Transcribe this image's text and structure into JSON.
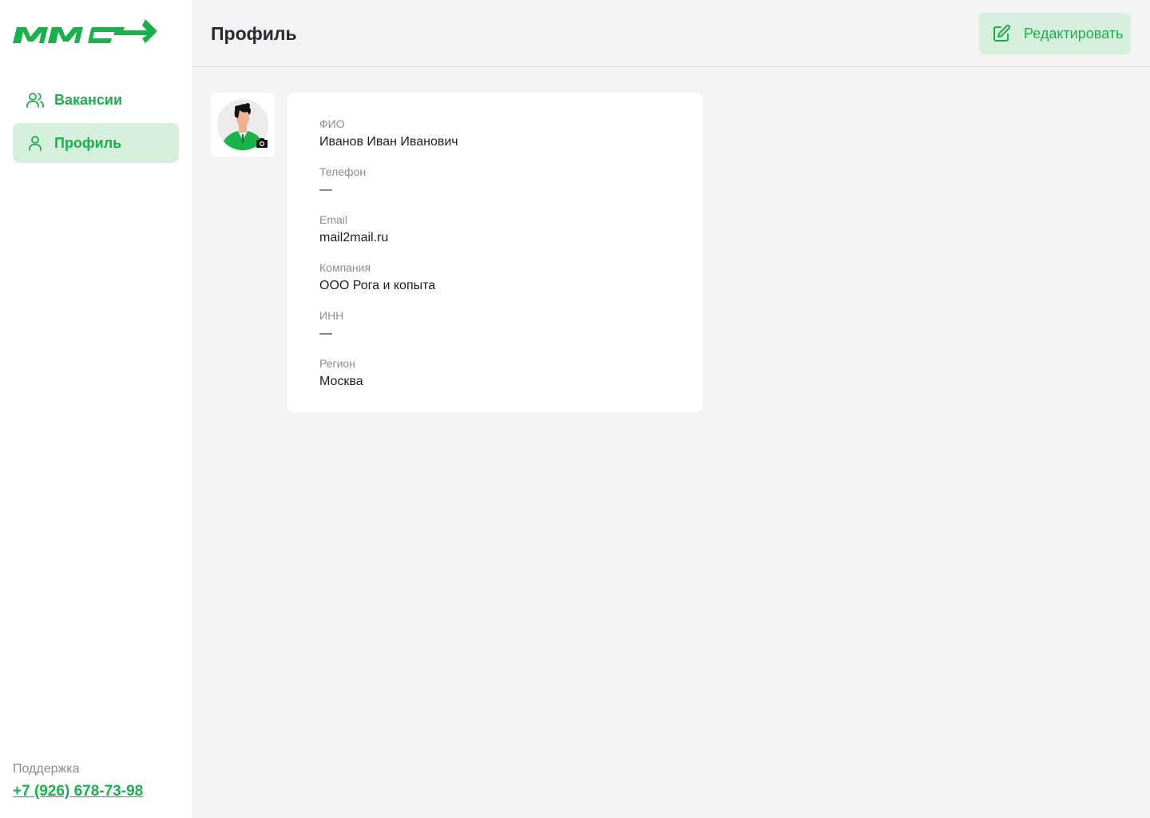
{
  "brand": {
    "logo_text": "MMC",
    "accent_color": "#17b24a",
    "accent_bg": "#d7f0de"
  },
  "sidebar": {
    "items": [
      {
        "label": "Вакансии",
        "icon": "users-icon",
        "active": false
      },
      {
        "label": "Профиль",
        "icon": "user-icon",
        "active": true
      }
    ],
    "support": {
      "caption": "Поддержка",
      "phone": "+7 (926) 678-73-98"
    }
  },
  "header": {
    "title": "Профиль",
    "edit_label": "Редактировать",
    "edit_icon": "edit-icon"
  },
  "profile": {
    "avatar_icon": "avatar-illustration",
    "upload_icon": "camera-icon",
    "fields": [
      {
        "label": "ФИО",
        "value": "Иванов Иван Иванович"
      },
      {
        "label": "Телефон",
        "value": "—"
      },
      {
        "label": "Email",
        "value": "mail2mail.ru"
      },
      {
        "label": "Компания",
        "value": "ООО Рога и копыта"
      },
      {
        "label": "ИНН",
        "value": "—"
      },
      {
        "label": "Регион",
        "value": "Москва"
      }
    ]
  }
}
